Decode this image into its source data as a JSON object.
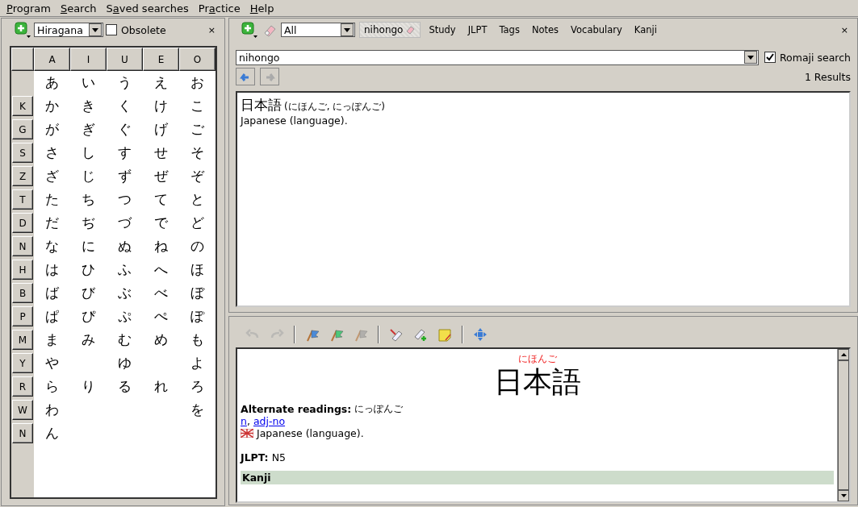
{
  "menu": [
    {
      "access_key": "P",
      "rest": "rogram"
    },
    {
      "access_key": "S",
      "rest": "earch"
    },
    {
      "start": "S",
      "access_key": "a",
      "rest": "ved searches"
    },
    {
      "start": "Pr",
      "access_key": "a",
      "rest": "ctice"
    },
    {
      "access_key": "H",
      "rest": "elp"
    }
  ],
  "kana_panel": {
    "script": "Hiragana",
    "obsolete": {
      "label": "Obsolete",
      "checked": false
    },
    "close": "×",
    "columns": [
      "A",
      "I",
      "U",
      "E",
      "O"
    ],
    "rows": [
      {
        "a": "あ",
        "i": "い",
        "u": "う",
        "e": "え",
        "o": "お"
      },
      {
        "label": "K",
        "a": "か",
        "i": "き",
        "u": "く",
        "e": "け",
        "o": "こ"
      },
      {
        "label": "G",
        "a": "が",
        "i": "ぎ",
        "u": "ぐ",
        "e": "げ",
        "o": "ご"
      },
      {
        "label": "S",
        "a": "さ",
        "i": "し",
        "u": "す",
        "e": "せ",
        "o": "そ"
      },
      {
        "label": "Z",
        "a": "ざ",
        "i": "じ",
        "u": "ず",
        "e": "ぜ",
        "o": "ぞ"
      },
      {
        "label": "T",
        "a": "た",
        "i": "ち",
        "u": "つ",
        "e": "て",
        "o": "と"
      },
      {
        "label": "D",
        "a": "だ",
        "i": "ぢ",
        "u": "づ",
        "e": "で",
        "o": "ど"
      },
      {
        "label": "N",
        "a": "な",
        "i": "に",
        "u": "ぬ",
        "e": "ね",
        "o": "の"
      },
      {
        "label": "H",
        "a": "は",
        "i": "ひ",
        "u": "ふ",
        "e": "へ",
        "o": "ほ"
      },
      {
        "label": "B",
        "a": "ば",
        "i": "び",
        "u": "ぶ",
        "e": "べ",
        "o": "ぼ"
      },
      {
        "label": "P",
        "a": "ぱ",
        "i": "ぴ",
        "u": "ぷ",
        "e": "ぺ",
        "o": "ぽ"
      },
      {
        "label": "M",
        "a": "ま",
        "i": "み",
        "u": "む",
        "e": "め",
        "o": "も"
      },
      {
        "label": "Y",
        "a": "や",
        "u": "ゆ",
        "o": "よ"
      },
      {
        "label": "R",
        "a": "ら",
        "i": "り",
        "u": "る",
        "e": "れ",
        "o": "ろ"
      },
      {
        "label": "W",
        "a": "わ",
        "o": "を"
      },
      {
        "label": "N",
        "a": "ん"
      }
    ]
  },
  "search_panel": {
    "filter": "All",
    "tags": [
      {
        "label": "nihongo"
      }
    ],
    "menus": [
      "Study",
      "JLPT",
      "Tags",
      "Notes",
      "Vocabulary",
      "Kanji"
    ],
    "close": "×",
    "query": "nihongo",
    "romaji_search": {
      "label": "Romaji search",
      "checked": true
    },
    "back": {
      "disabled": false
    },
    "forward": {
      "disabled": true
    },
    "result_count": "1 Results",
    "results": [
      {
        "word": "日本語",
        "readings": "(にほんご, にっぽんご)",
        "meaning": "Japanese (language)."
      }
    ]
  },
  "detail_toolbar": [
    {
      "kind": "undo",
      "disabled": true
    },
    {
      "kind": "redo",
      "disabled": true
    },
    {
      "kind": "separator"
    },
    {
      "kind": "flag",
      "color": "#4a8ad8",
      "disabled": false
    },
    {
      "kind": "flag",
      "color": "#4cc77a",
      "disabled": false
    },
    {
      "kind": "flag",
      "color": "#9a9a9a",
      "disabled": true
    },
    {
      "kind": "separator"
    },
    {
      "kind": "tag-edit",
      "disabled": false
    },
    {
      "kind": "tag-add",
      "disabled": false
    },
    {
      "kind": "note",
      "disabled": false
    },
    {
      "kind": "separator"
    },
    {
      "kind": "move",
      "disabled": false
    }
  ],
  "detail": {
    "reading": "にほんご",
    "word": "日本語",
    "alternate_label": "Alternate readings:",
    "alternate": "にっぽんご",
    "pos": [
      "n",
      "adj-no"
    ],
    "pos_separator": ",",
    "gloss": "Japanese (language).",
    "jlpt_label": "JLPT:",
    "jlpt": "N5",
    "section": "Kanji"
  }
}
